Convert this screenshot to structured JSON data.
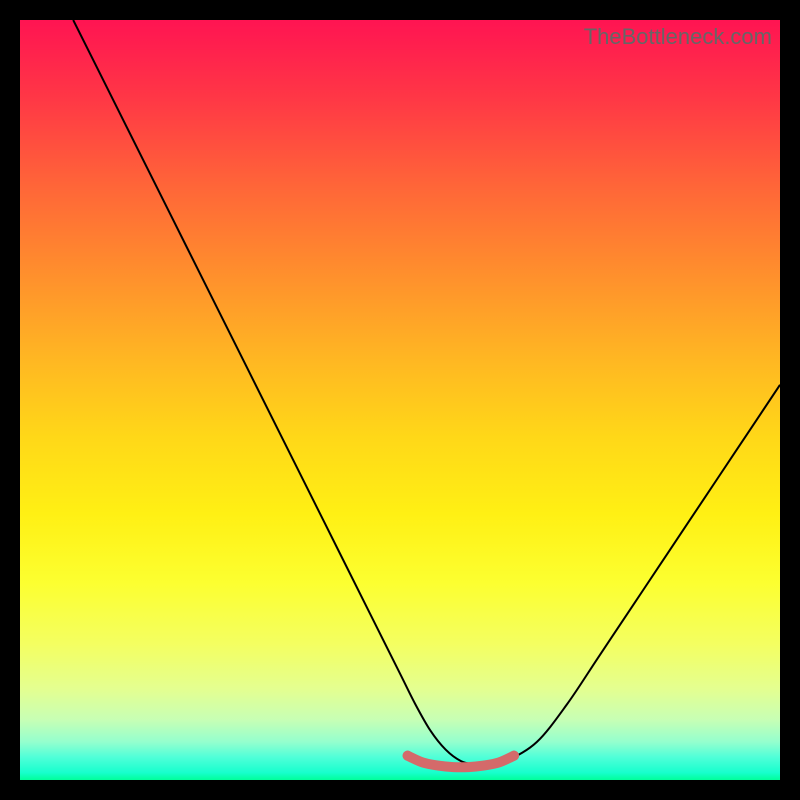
{
  "watermark": "TheBottleneck.com",
  "chart_data": {
    "type": "line",
    "title": "",
    "xlabel": "",
    "ylabel": "",
    "xlim": [
      0,
      100
    ],
    "ylim": [
      0,
      100
    ],
    "grid": false,
    "series": [
      {
        "name": "bottleneck-curve",
        "color": "#000000",
        "x": [
          7,
          10,
          14,
          18,
          22,
          26,
          30,
          34,
          38,
          42,
          46,
          50,
          52,
          54,
          56,
          58,
          60,
          62,
          64,
          68,
          72,
          76,
          80,
          84,
          88,
          92,
          96,
          100
        ],
        "y": [
          100,
          94,
          86,
          78,
          70,
          62,
          54,
          46,
          38,
          30,
          22,
          14,
          10,
          6.5,
          4,
          2.5,
          2,
          2,
          2.5,
          5,
          10,
          16,
          22,
          28,
          34,
          40,
          46,
          52
        ]
      },
      {
        "name": "trough-marker",
        "color": "#d46a6a",
        "stroke_width": 10,
        "x": [
          51,
          53,
          55,
          57,
          59,
          61,
          63,
          65
        ],
        "y": [
          3.2,
          2.3,
          1.9,
          1.7,
          1.7,
          1.9,
          2.3,
          3.2
        ]
      }
    ],
    "background_gradient": {
      "top": "#ff1452",
      "bottom": "#00ff9a"
    }
  }
}
